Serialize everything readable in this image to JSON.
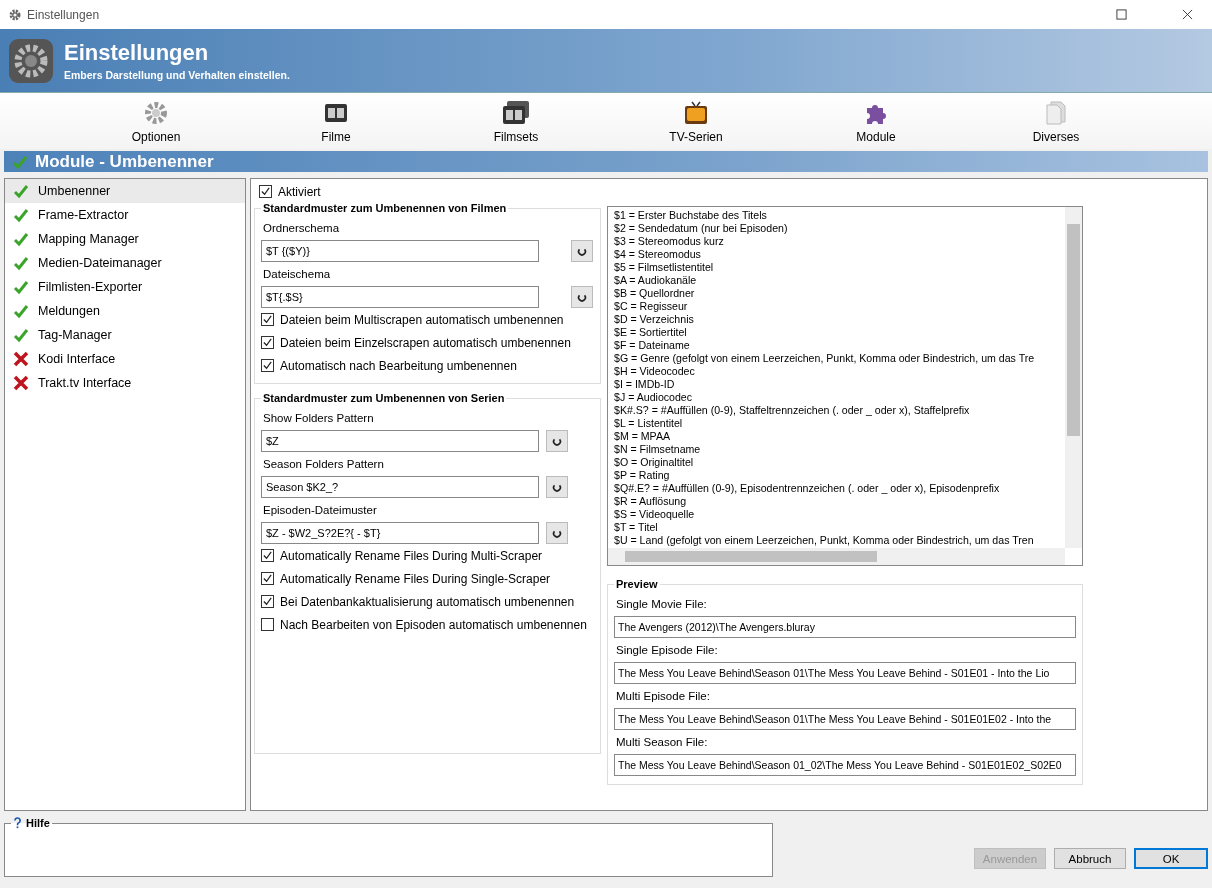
{
  "window": {
    "title": "Einstellungen"
  },
  "header": {
    "title": "Einstellungen",
    "subtitle": "Embers Darstellung und Verhalten einstellen."
  },
  "categories": [
    {
      "label": "Optionen",
      "kind": "gear"
    },
    {
      "label": "Filme",
      "kind": "film"
    },
    {
      "label": "Filmsets",
      "kind": "filmset"
    },
    {
      "label": "TV-Serien",
      "kind": "tv"
    },
    {
      "label": "Module",
      "kind": "puzzle"
    },
    {
      "label": "Diverses",
      "kind": "document"
    }
  ],
  "section": {
    "title": "Module - Umbenenner"
  },
  "modules": [
    {
      "label": "Umbenenner",
      "enabled": true,
      "selected": true
    },
    {
      "label": "Frame-Extractor",
      "enabled": true,
      "selected": false
    },
    {
      "label": "Mapping Manager",
      "enabled": true,
      "selected": false
    },
    {
      "label": "Medien-Dateimanager",
      "enabled": true,
      "selected": false
    },
    {
      "label": "Filmlisten-Exporter",
      "enabled": true,
      "selected": false
    },
    {
      "label": "Meldungen",
      "enabled": true,
      "selected": false
    },
    {
      "label": "Tag-Manager",
      "enabled": true,
      "selected": false
    },
    {
      "label": "Kodi Interface",
      "enabled": false,
      "selected": false
    },
    {
      "label": "Trakt.tv Interface",
      "enabled": false,
      "selected": false
    }
  ],
  "activated": {
    "label": "Aktiviert",
    "checked": true
  },
  "groups": [
    {
      "title": "Standardmuster zum Umbenennen von Filmen",
      "fields": [
        {
          "label": "Ordnerschema",
          "value": "$T {($Y)}"
        },
        {
          "label": "Dateischema",
          "value": "$T{.$S}"
        }
      ],
      "options": [
        {
          "label": "Dateien beim Multiscrapen automatisch umbenennen",
          "checked": true
        },
        {
          "label": "Dateien beim Einzelscrapen automatisch umbenennen",
          "checked": true
        },
        {
          "label": "Automatisch nach Bearbeitung umbenennen",
          "checked": true
        }
      ]
    },
    {
      "title": "Standardmuster zum Umbenennen von Serien",
      "fields": [
        {
          "label": "Show Folders Pattern",
          "value": "$Z"
        },
        {
          "label": "Season Folders Pattern",
          "value": "Season $K2_?"
        },
        {
          "label": "Episoden-Dateimuster",
          "value": "$Z - $W2_S?2E?{ - $T}"
        }
      ],
      "options": [
        {
          "label": "Automatically Rename Files During Multi-Scraper",
          "checked": true
        },
        {
          "label": "Automatically Rename Files During Single-Scraper",
          "checked": true
        },
        {
          "label": "Bei Datenbankaktualisierung automatisch umbenennen",
          "checked": true
        },
        {
          "label": "Nach Bearbeiten von Episoden automatisch umbenennen",
          "checked": false
        }
      ]
    }
  ],
  "placeholders": [
    "$1 = Erster Buchstabe des Titels",
    "$2 = Sendedatum (nur bei Episoden)",
    "$3 = Stereomodus kurz",
    "$4 = Stereomodus",
    "$5 = Filmsetlistentitel",
    "$A = Audiokanäle",
    "$B = Quellordner",
    "$C = Regisseur",
    "$D = Verzeichnis",
    "$E = Sortiertitel",
    "$F = Dateiname",
    "$G = Genre (gefolgt von einem Leerzeichen, Punkt, Komma oder Bindestrich, um das Tre",
    "$H = Videocodec",
    "$I = IMDb-ID",
    "$J = Audiocodec",
    "$K#.S? = #Auffüllen (0-9), Staffeltrennzeichen (. oder _ oder x), Staffelprefix",
    "$L = Listentitel",
    "$M = MPAA",
    "$N = Filmsetname",
    "$O = Originaltitel",
    "$P = Rating",
    "$Q#.E? = #Auffüllen (0-9), Episodentrennzeichen (. oder _ oder x), Episodenprefix",
    "$R = Auflösung",
    "$S = Videoquelle",
    "$T = Titel",
    "$U = Land (gefolgt von einem Leerzeichen, Punkt, Komma oder Bindestrich, um das Tren"
  ],
  "preview": {
    "title": "Preview",
    "files": [
      {
        "label": "Single Movie File:",
        "value": "The Avengers (2012)\\The Avengers.bluray"
      },
      {
        "label": "Single Episode File:",
        "value": "The Mess You Leave Behind\\Season 01\\The Mess You Leave Behind - S01E01 - Into the Lio"
      },
      {
        "label": "Multi Episode File:",
        "value": "The Mess You Leave Behind\\Season 01\\The Mess You Leave Behind - S01E01E02 - Into the"
      },
      {
        "label": "Multi Season File:",
        "value": "The Mess You Leave Behind\\Season 01_02\\The Mess You Leave Behind - S01E01E02_S02E0"
      }
    ]
  },
  "help": {
    "title": "Hilfe"
  },
  "buttons": [
    {
      "label": "Anwenden",
      "disabled": true,
      "default": false
    },
    {
      "label": "Abbruch",
      "disabled": false,
      "default": false
    },
    {
      "label": "OK",
      "disabled": false,
      "default": true
    }
  ]
}
